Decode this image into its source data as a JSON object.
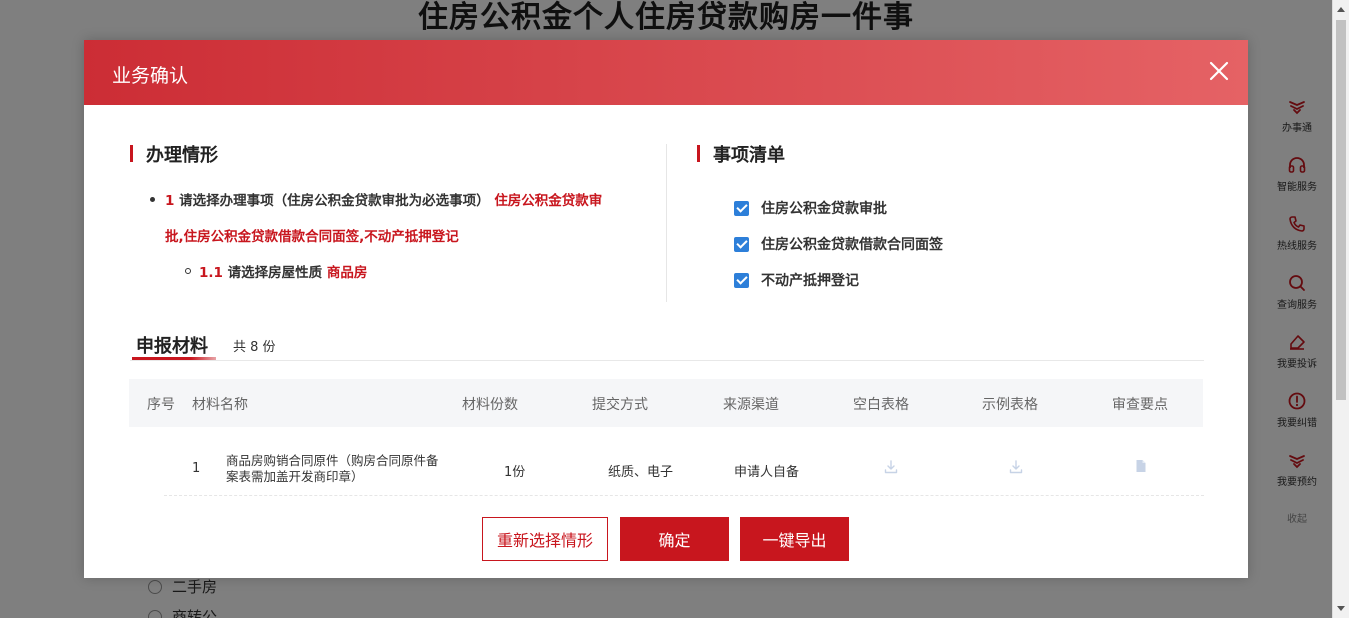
{
  "background": {
    "page_title": "住房公积金个人住房贷款购房一件事",
    "radio_options": [
      "二手房",
      "商转公"
    ]
  },
  "right_bar": {
    "items": [
      {
        "label": "办事通",
        "icon": "handshake-icon"
      },
      {
        "label": "智能服务",
        "icon": "headset-icon"
      },
      {
        "label": "热线服务",
        "icon": "phone-icon"
      },
      {
        "label": "查询服务",
        "icon": "search-icon"
      },
      {
        "label": "我要投诉",
        "icon": "eraser-icon"
      },
      {
        "label": "我要纠错",
        "icon": "alert-circle-icon"
      },
      {
        "label": "我要预约",
        "icon": "handshake-icon"
      }
    ],
    "collapse_label": "收起"
  },
  "modal": {
    "title": "业务确认",
    "close_icon": "close-icon",
    "situation": {
      "title": "办理情形",
      "q1_number": "1",
      "q1_text": "请选择办理事项（住房公积金贷款审批为必选事项）",
      "q1_answer_part1": "住房公积金贷款审",
      "q1_answer_part2": "批,住房公积金贷款借款合同面签,不动产抵押登记",
      "q11_number": "1.1",
      "q11_text": "请选择房屋性质",
      "q11_answer": "商品房"
    },
    "checklist": {
      "title": "事项清单",
      "items": [
        "住房公积金贷款审批",
        "住房公积金贷款借款合同面签",
        "不动产抵押登记"
      ]
    },
    "materials": {
      "tab_label": "申报材料",
      "count_text": "共 8 份",
      "columns": [
        "序号",
        "材料名称",
        "材料份数",
        "提交方式",
        "来源渠道",
        "空白表格",
        "示例表格",
        "审查要点"
      ],
      "rows": [
        {
          "index": "1",
          "name_line1": "商品房购销合同原件（购房合同原件备",
          "name_line2": "案表需加盖开发商印章）",
          "copies": "1份",
          "method": "纸质、电子",
          "source": "申请人自备"
        }
      ]
    },
    "buttons": {
      "reselect": "重新选择情形",
      "confirm": "确定",
      "export": "一键导出"
    }
  },
  "colors": {
    "brand_red": "#c8161e",
    "header_gradient_start": "#cc2d35",
    "header_gradient_end": "#e56265",
    "checkbox_blue": "#2d7fd9"
  }
}
